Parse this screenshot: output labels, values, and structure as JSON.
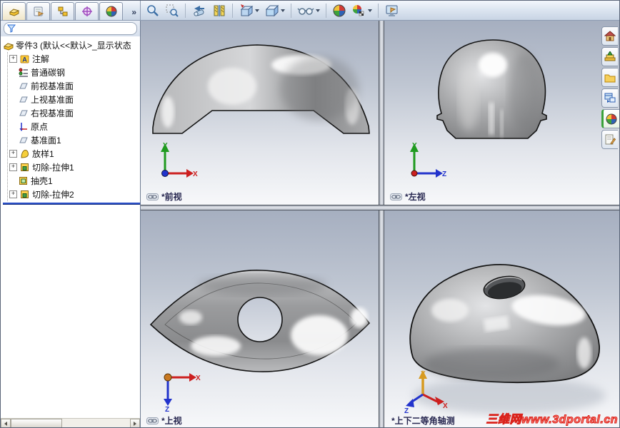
{
  "glyphs": {
    "plus": "+",
    "overflow": "»",
    "annotation_a": "A"
  },
  "colors": {
    "rollback_blue": "#2b50c8",
    "watermark_red": "#da231c",
    "viewport_top": "#a6afc0",
    "viewport_bottom": "#f7f8fa",
    "axis_x_red": "#cc1f1f",
    "axis_y_green": "#1f9a1f",
    "axis_z_blue": "#2233cc",
    "axis_y_gold": "#d79a20"
  },
  "feature_manager": {
    "tabs": [
      "featuremanager-design-tree",
      "propertymanager",
      "configurationmanager",
      "dimxpertmanager",
      "displaymanager"
    ],
    "filter_value": "",
    "root_label": "零件3 (默认<<默认>_显示状态",
    "items": [
      {
        "label": "注解",
        "icon": "annotations",
        "expandable": true
      },
      {
        "label": "普通碳钢",
        "icon": "material",
        "expandable": false
      },
      {
        "label": "前视基准面",
        "icon": "plane",
        "expandable": false
      },
      {
        "label": "上视基准面",
        "icon": "plane",
        "expandable": false
      },
      {
        "label": "右视基准面",
        "icon": "plane",
        "expandable": false
      },
      {
        "label": "原点",
        "icon": "origin",
        "expandable": false
      },
      {
        "label": "基准面1",
        "icon": "plane",
        "expandable": false
      },
      {
        "label": "放样1",
        "icon": "loft",
        "expandable": true
      },
      {
        "label": "切除-拉伸1",
        "icon": "cut-extrude",
        "expandable": true
      },
      {
        "label": "抽壳1",
        "icon": "shell",
        "expandable": false
      },
      {
        "label": "切除-拉伸2",
        "icon": "cut-extrude",
        "expandable": true
      }
    ]
  },
  "toolbar_icons": [
    "zoom-in-out",
    "zoom-to-area",
    "previous-view",
    "section-view",
    "view-orientation",
    "display-style",
    "hide-show-items",
    "edit-appearance",
    "apply-scene",
    "view-settings"
  ],
  "viewports": {
    "front": {
      "label": "*前视",
      "triad": {
        "up": "Y",
        "right": "X"
      }
    },
    "left": {
      "label": "*左视",
      "triad": {
        "up": "Y",
        "right": "Z"
      }
    },
    "top": {
      "label": "*上视",
      "triad": {
        "right": "X",
        "down": "Z"
      }
    },
    "iso": {
      "label": "*上下二等角轴测",
      "triad": {
        "up": "Y",
        "right": "X",
        "left": "Z"
      }
    }
  },
  "task_pane_icons": [
    "solidworks-resources",
    "design-library",
    "file-explorer",
    "view-palette",
    "appearances-scenes",
    "custom-properties"
  ],
  "watermark": {
    "text": "三维网www.3dportal.cn"
  }
}
